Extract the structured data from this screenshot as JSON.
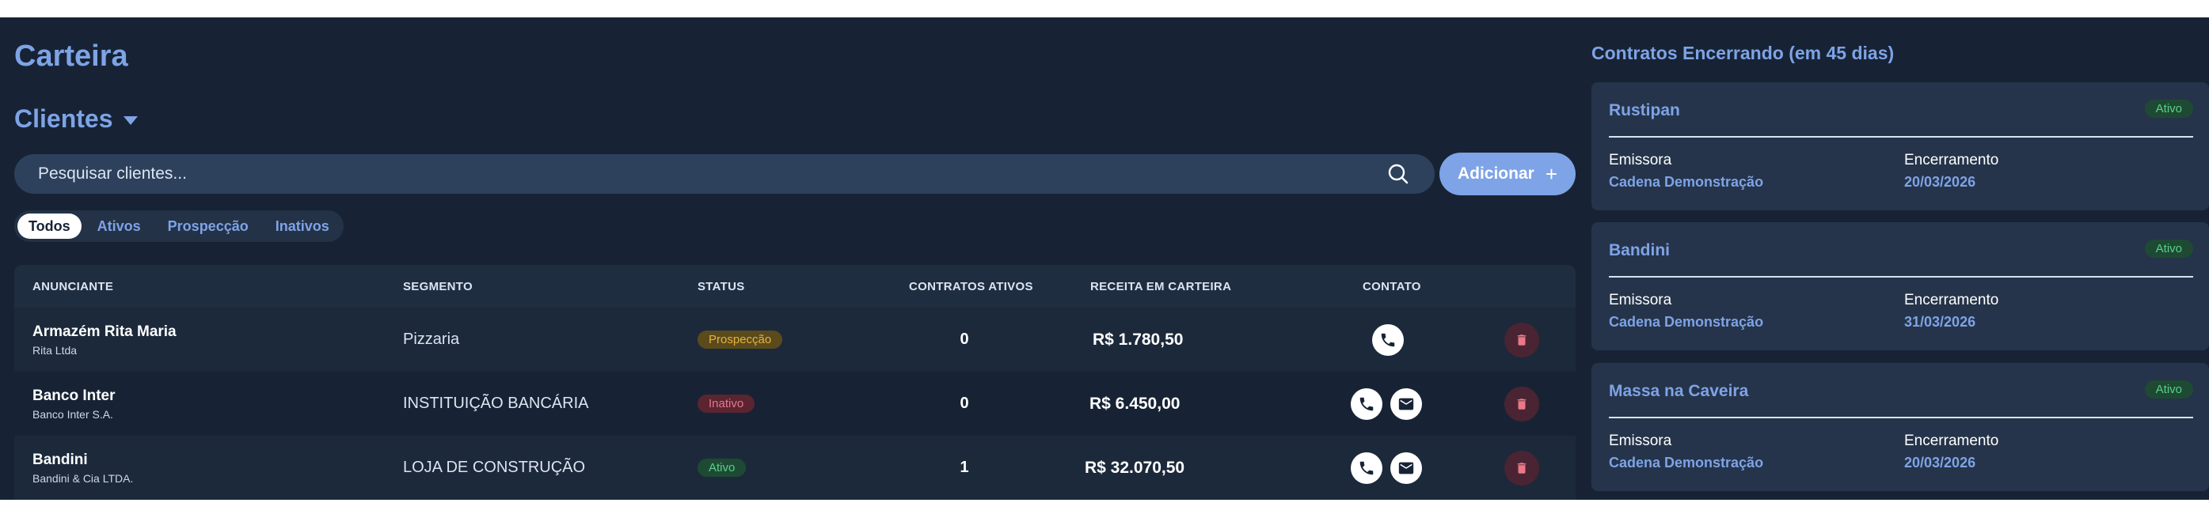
{
  "page": {
    "title": "Carteira",
    "section_title": "Clientes",
    "search_placeholder": "Pesquisar clientes...",
    "add_label": "Adicionar"
  },
  "filters": [
    "Todos",
    "Ativos",
    "Prospecção",
    "Inativos"
  ],
  "table": {
    "columns": [
      "ANUNCIANTE",
      "SEGMENTO",
      "STATUS",
      "CONTRATOS ATIVOS",
      "RECEITA EM CARTEIRA",
      "CONTATO"
    ],
    "rows": [
      {
        "name": "Armazém Rita Maria",
        "company": "Rita Ltda",
        "segment": "Pizzaria",
        "status": "Prospecção",
        "contracts": "0",
        "revenue": "R$ 1.780,50"
      },
      {
        "name": "Banco Inter",
        "company": "Banco Inter S.A.",
        "segment": "INSTITUIÇÃO BANCÁRIA",
        "status": "Inativo",
        "contracts": "0",
        "revenue": "R$ 6.450,00"
      },
      {
        "name": "Bandini",
        "company": "Bandini & Cia LTDA.",
        "segment": "LOJA DE CONSTRUÇÃO",
        "status": "Ativo",
        "contracts": "1",
        "revenue": "R$ 32.070,50"
      }
    ]
  },
  "sidebar": {
    "title": "Contratos Encerrando (em 45 dias)",
    "label_issuer": "Emissora",
    "label_end": "Encerramento",
    "cards": [
      {
        "name": "Rustipan",
        "status": "Ativo",
        "issuer": "Cadena Demonstração",
        "end_date": "20/03/2026"
      },
      {
        "name": "Bandini",
        "status": "Ativo",
        "issuer": "Cadena Demonstração",
        "end_date": "31/03/2026"
      },
      {
        "name": "Massa na Caveira",
        "status": "Ativo",
        "issuer": "Cadena Demonstração",
        "end_date": "20/03/2026"
      }
    ]
  },
  "colors": {
    "background": "#172335",
    "accent": "#7ea3e6",
    "status_active": "#58d18a",
    "status_inactive": "#e8788a",
    "status_prospect": "#e6b33e"
  },
  "icons": [
    "search-icon",
    "plus-icon",
    "chevron-down-icon",
    "phone-icon",
    "mail-icon",
    "trash-icon"
  ]
}
